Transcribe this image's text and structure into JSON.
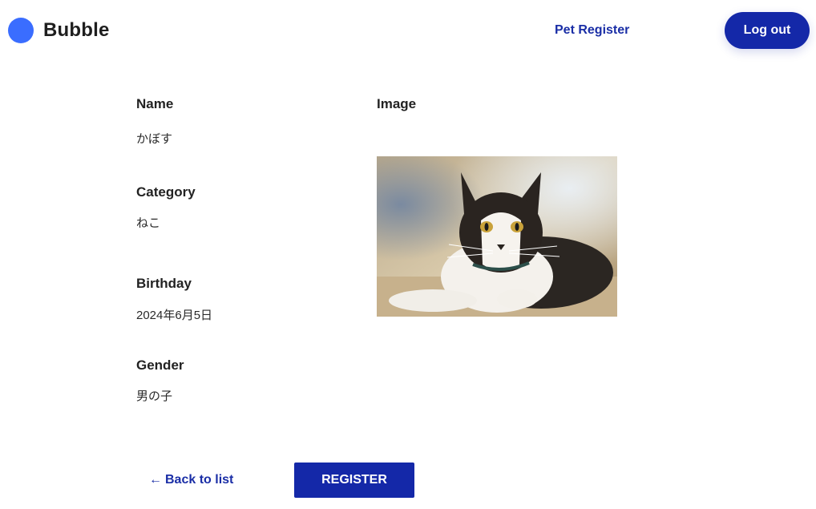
{
  "header": {
    "brand_name": "Bubble",
    "nav_link": "Pet Register",
    "logout_label": "Log out"
  },
  "pet": {
    "name_label": "Name",
    "name_value": "かぼす",
    "category_label": "Category",
    "category_value": "ねこ",
    "birthday_label": "Birthday",
    "birthday_value": "2024年6月5日",
    "gender_label": "Gender",
    "gender_value": "男の子",
    "image_label": "Image"
  },
  "actions": {
    "back_arrow": "←",
    "back_label": "Back to list",
    "register_label": "REGISTER"
  },
  "colors": {
    "brand_dot": "#3a6dff",
    "primary": "#1428a8",
    "link": "#1a2ea6"
  }
}
